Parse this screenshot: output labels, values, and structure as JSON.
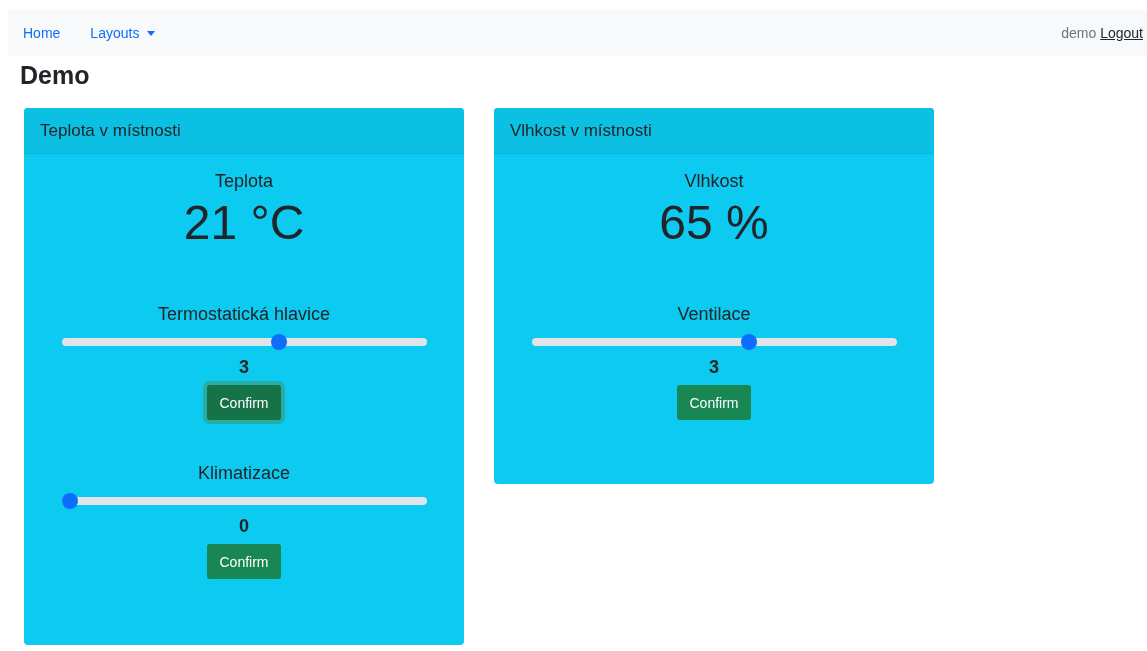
{
  "navbar": {
    "links": [
      {
        "label": "Home",
        "kind": "link"
      },
      {
        "label": "Layouts",
        "kind": "dropdown"
      }
    ],
    "user": "demo",
    "logout": "Logout"
  },
  "page_title": "Demo",
  "cards": [
    {
      "title": "Teplota v místnosti",
      "reading_label": "Teplota",
      "reading": "21 °C",
      "controls": [
        {
          "label": "Termostatická hlavice",
          "level": 0.6,
          "value": "3",
          "button": "Confirm",
          "focused": true
        },
        {
          "label": "Klimatizace",
          "level": 0,
          "value": "0",
          "button": "Confirm",
          "focused": false
        }
      ]
    },
    {
      "title": "Vlhkost v místnosti",
      "reading_label": "Vlhkost",
      "reading": "65 %",
      "controls": [
        {
          "label": "Ventilace",
          "level": 0.6,
          "value": "3",
          "button": "Confirm",
          "focused": false
        }
      ]
    }
  ]
}
